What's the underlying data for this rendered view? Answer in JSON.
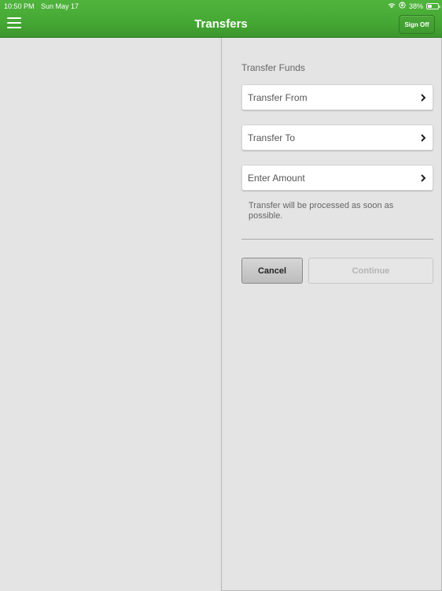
{
  "status_bar": {
    "time": "10:50 PM",
    "date": "Sun May 17",
    "battery_percent": "38%",
    "battery_level": 0.38
  },
  "header": {
    "title": "Transfers",
    "menu_icon": "hamburger-menu-icon",
    "sign_off_label": "Sign Off",
    "color": "#46a834"
  },
  "form": {
    "section_title": "Transfer Funds",
    "fields": [
      {
        "label": "Transfer From",
        "icon": "chevron-right-icon"
      },
      {
        "label": "Transfer To",
        "icon": "chevron-right-icon"
      },
      {
        "label": "Enter Amount",
        "icon": "chevron-right-icon"
      }
    ],
    "note": "Transfer will be processed as soon as possible.",
    "cancel_label": "Cancel",
    "continue_label": "Continue",
    "continue_enabled": false
  }
}
